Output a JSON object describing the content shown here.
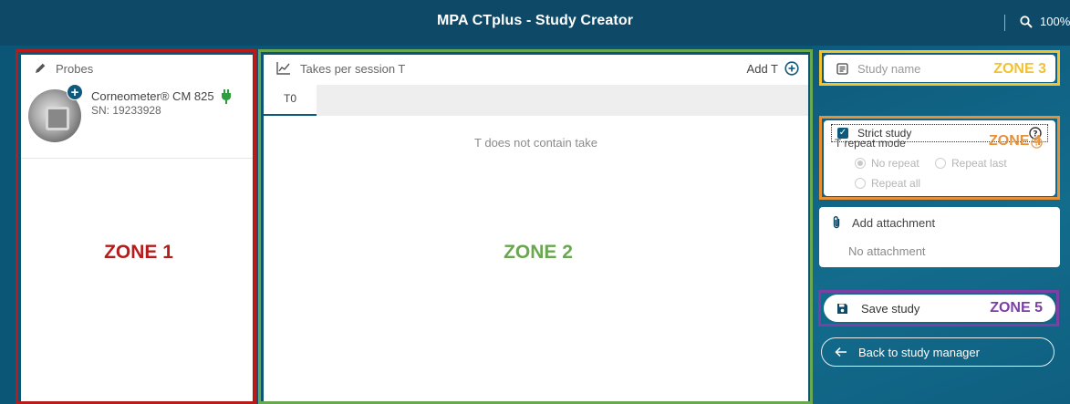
{
  "app": {
    "title": "MPA CTplus - Study Creator",
    "zoom": "100%"
  },
  "probes": {
    "header": "Probes",
    "items": [
      {
        "name": "Corneometer® CM 825",
        "sn": "SN: 19233928"
      }
    ]
  },
  "takes": {
    "header": "Takes per session T",
    "add_label": "Add T",
    "tabs": [
      "T0"
    ],
    "empty_message": "T does not contain take"
  },
  "study": {
    "name_placeholder": "Study name",
    "strict_label": "Strict study",
    "strict_checked": true,
    "repeat_mode_label": "T repeat mode",
    "repeat_options": [
      "No repeat",
      "Repeat last",
      "Repeat all"
    ],
    "repeat_selected": "No repeat",
    "attachment_label": "Add attachment",
    "attachment_status": "No attachment",
    "save_label": "Save study",
    "back_label": "Back to study manager"
  },
  "zones": {
    "zone1": "ZONE 1",
    "zone2": "ZONE 2",
    "zone3": "ZONE 3",
    "zone4": "ZONE 4",
    "zone5": "ZONE 5"
  },
  "colors": {
    "header_bg": "#0e4a68",
    "accent": "#0e5a7c",
    "zone1": "#b71c1c",
    "zone2": "#6aa84f",
    "zone3": "#f1c232",
    "zone4": "#e69138",
    "zone5": "#7b3fa6",
    "plug_green": "#2e9e3e"
  }
}
